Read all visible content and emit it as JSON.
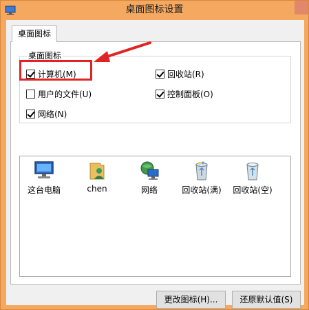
{
  "window": {
    "title": "桌面图标设置"
  },
  "tabs": [
    {
      "label": "桌面图标"
    }
  ],
  "group": {
    "legend": "桌面图标",
    "checkboxes": [
      {
        "label": "计算机(M)",
        "checked": true
      },
      {
        "label": "用户的文件(U)",
        "checked": false
      },
      {
        "label": "网络(N)",
        "checked": true
      },
      {
        "label": "回收站(R)",
        "checked": true
      },
      {
        "label": "控制面板(O)",
        "checked": true
      }
    ]
  },
  "icons": [
    {
      "label": "这台电脑",
      "icon": "computer-icon"
    },
    {
      "label": "chen",
      "icon": "user-folder-icon"
    },
    {
      "label": "网络",
      "icon": "network-icon"
    },
    {
      "label": "回收站(满)",
      "icon": "recycle-bin-full-icon"
    },
    {
      "label": "回收站(空)",
      "icon": "recycle-bin-empty-icon"
    }
  ],
  "buttons": {
    "change_icon": "更改图标(H)...",
    "restore_default": "还原默认值(S)"
  },
  "annotation": {
    "highlight_color": "#e02424"
  },
  "colors": {
    "titlebar": "#f5a860",
    "panel": "#ffffff",
    "client": "#f0f0f0"
  }
}
